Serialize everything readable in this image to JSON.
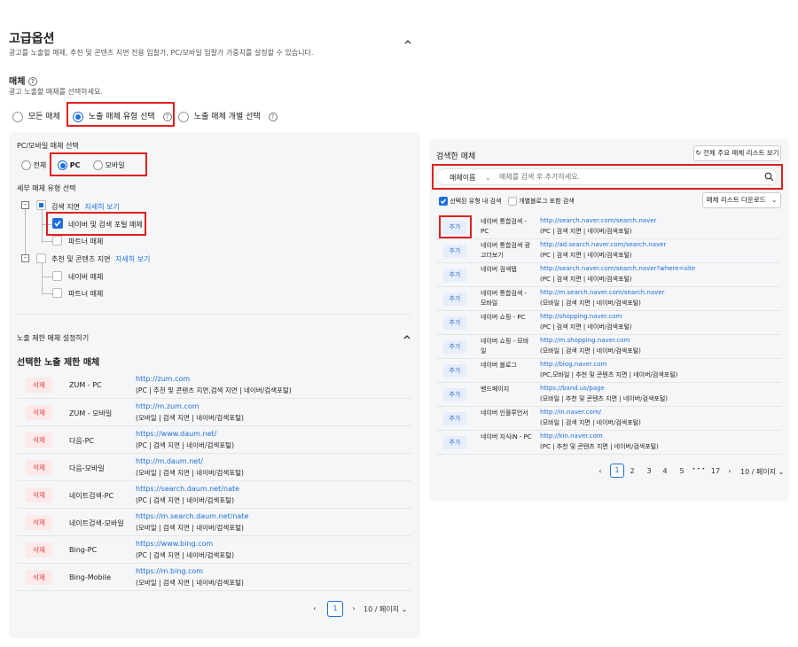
{
  "header": {
    "title": "고급옵션",
    "desc": "광고를 노출할 매체, 추천 및 콘텐츠 지면 전용 입찰가, PC/모바일 입찰가 가중치를 설정할 수 있습니다."
  },
  "media": {
    "title": "매체",
    "desc": "광고 노출할 매체를 선택하세요.",
    "options": [
      "모든 매체",
      "노출 매체 유형 선택",
      "노출 매체 개별 선택"
    ]
  },
  "left": {
    "device_title": "PC/모바일 매체 선택",
    "device_options": [
      "전체",
      "PC",
      "모바일"
    ],
    "detail_title": "세부 매체 유형 선택",
    "tree": {
      "search": "검색 지면",
      "search_more": "자세히 보기",
      "naver_portal": "네이버 및 검색 포털 매체",
      "partner": "파트너 매체",
      "recommend": "추천 및 콘텐츠 지면",
      "recommend_more": "자세히 보기",
      "naver": "네이버 매체",
      "partner2": "파트너 매체"
    },
    "limit_title": "노출 제한 매체 설정하기",
    "selected_title": "선택한 노출 제한 매체",
    "delete_label": "삭제",
    "rows": [
      {
        "name": "ZUM - PC",
        "url": "http://zum.com",
        "desc": "(PC | 추천 및 콘텐츠 지면,검색 지면 | 네이버/검색포털)"
      },
      {
        "name": "ZUM - 모바일",
        "url": "http://m.zum.com",
        "desc": "(모바일 | 검색 지면 | 네이버/검색포털)"
      },
      {
        "name": "다음-PC",
        "url": "https://www.daum.net/",
        "desc": "(PC | 검색 지면 | 네이버/검색포털)"
      },
      {
        "name": "다음-모바일",
        "url": "http://m.daum.net/",
        "desc": "(모바일 | 검색 지면 | 네이버/검색포털)"
      },
      {
        "name": "네이트검색-PC",
        "url": "https://search.daum.net/nate",
        "desc": "(PC | 검색 지면 | 네이버/검색포털)"
      },
      {
        "name": "네이트검색-모바일",
        "url": "https://m.search.daum.net/nate",
        "desc": "(모바일 | 검색 지면 | 네이버/검색포털)"
      },
      {
        "name": "Bing-PC",
        "url": "https://www.bing.com",
        "desc": "(PC | 검색 지면 | 네이버/검색포털)"
      },
      {
        "name": "Bing-Mobile",
        "url": "https://m.bing.com",
        "desc": "(모바일 | 검색 지면 | 네이버/검색포털)"
      }
    ],
    "pagination": {
      "current": "1",
      "per_page": "10 / 페이지"
    }
  },
  "right": {
    "title": "검색한 매체",
    "view_all": "전체 주요 매체 리스트 보기",
    "search_type": "매체이름",
    "search_placeholder": "매체를 검색 후 추가하세요.",
    "filter1": "선택된 유형 내 검색",
    "filter2": "개별블로그 포함 검색",
    "download": "매체 리스트 다운로드",
    "add_label": "추가",
    "rows": [
      {
        "name": "네이버 통합검색 - PC",
        "url": "http://search.naver.com/search.naver",
        "desc": "(PC | 검색 지면 | 네이버/검색포털)"
      },
      {
        "name": "네이버 통합검색 광고더보기",
        "url": "http://ad.search.naver.com/search.naver",
        "desc": "(PC | 검색 지면 | 네이버/검색포털)"
      },
      {
        "name": "네이버 검색탭",
        "url": "http://search.naver.com/search.naver?where=site",
        "desc": "(PC | 검색 지면 | 네이버/검색포털)"
      },
      {
        "name": "네이버 통합검색 - 모바일",
        "url": "http://m.search.naver.com/search.naver",
        "desc": "(모바일 | 검색 지면 | 네이버/검색포털)"
      },
      {
        "name": "네이버 쇼핑 - PC",
        "url": "http://shopping.naver.com",
        "desc": "(PC | 검색 지면 | 네이버/검색포털)"
      },
      {
        "name": "네이버 쇼핑 - 모바일",
        "url": "http://m.shopping.naver.com",
        "desc": "(모바일 | 검색 지면 | 네이버/검색포털)"
      },
      {
        "name": "네이버 블로그",
        "url": "http://blog.naver.com",
        "desc": "(PC,모바일 | 추천 및 콘텐츠 지면 | 네이버/검색포털)"
      },
      {
        "name": "밴드페이지",
        "url": "https://band.us/page",
        "desc": "(모바일 | 추천 및 콘텐츠 지면 | 네이버/검색포털)"
      },
      {
        "name": "네이버 인플루언서",
        "url": "http://in.naver.com/",
        "desc": "(모바일 | 검색 지면 | 네이버/검색포털)"
      },
      {
        "name": "네이버 지식iN - PC",
        "url": "http://kin.naver.com",
        "desc": "(PC | 추천 및 콘텐츠 지면 | 네이버/검색포털)"
      }
    ],
    "pagination": {
      "pages": [
        "1",
        "2",
        "3",
        "4",
        "5"
      ],
      "ellipsis": "• • •",
      "last": "17",
      "per_page": "10 / 페이지"
    }
  }
}
